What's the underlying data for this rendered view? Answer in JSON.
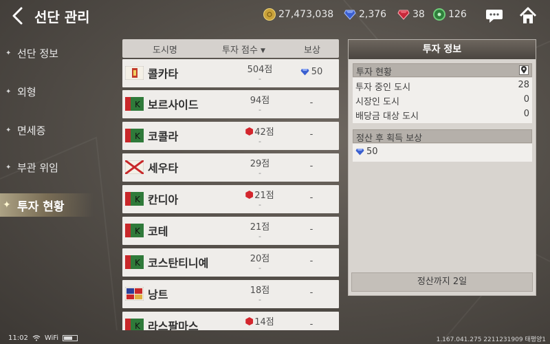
{
  "header": {
    "title": "선단 관리",
    "currencies": [
      {
        "icon": "gold-coin-icon",
        "value": "27,473,038",
        "color": "#c9a23a"
      },
      {
        "icon": "blue-gem-icon",
        "value": "2,376",
        "color": "#3a5fd0"
      },
      {
        "icon": "red-gem-icon",
        "value": "38",
        "color": "#c8283a"
      },
      {
        "icon": "green-gear-icon",
        "value": "126",
        "color": "#3aa24a"
      }
    ]
  },
  "sidebar": {
    "items": [
      {
        "label": "선단 정보",
        "active": false
      },
      {
        "label": "외형",
        "active": false
      },
      {
        "label": "면세증",
        "active": false
      },
      {
        "label": "부관 위임",
        "active": false
      },
      {
        "label": "투자 현황",
        "active": true
      }
    ]
  },
  "table": {
    "headers": {
      "city": "도시명",
      "score": "투자 점수",
      "reward": "보상"
    },
    "rows": [
      {
        "city": "콜카타",
        "score": "504점",
        "sub": "-",
        "reward": "50",
        "reward_gem": true,
        "red_marker": false
      },
      {
        "city": "보르사이드",
        "score": "94점",
        "sub": "-",
        "reward": "-",
        "reward_gem": false,
        "red_marker": false
      },
      {
        "city": "코콜라",
        "score": "42점",
        "sub": "-",
        "reward": "-",
        "reward_gem": false,
        "red_marker": true
      },
      {
        "city": "세우타",
        "score": "29점",
        "sub": "-",
        "reward": "-",
        "reward_gem": false,
        "red_marker": false
      },
      {
        "city": "칸디아",
        "score": "21점",
        "sub": "-",
        "reward": "-",
        "reward_gem": false,
        "red_marker": true
      },
      {
        "city": "코테",
        "score": "21점",
        "sub": "-",
        "reward": "-",
        "reward_gem": false,
        "red_marker": false
      },
      {
        "city": "코스탄티니예",
        "score": "20점",
        "sub": "-",
        "reward": "-",
        "reward_gem": false,
        "red_marker": false
      },
      {
        "city": "낭트",
        "score": "18점",
        "sub": "-",
        "reward": "-",
        "reward_gem": false,
        "red_marker": false
      },
      {
        "city": "라스팔마스",
        "score": "14점",
        "sub": "-",
        "reward": "-",
        "reward_gem": false,
        "red_marker": true
      }
    ]
  },
  "panel": {
    "title": "투자 정보",
    "status_section": {
      "title": "투자 현황",
      "items": [
        {
          "label": "투자 중인 도시",
          "value": "28"
        },
        {
          "label": "시장인 도시",
          "value": "0"
        },
        {
          "label": "배당금 대상 도시",
          "value": "0"
        }
      ]
    },
    "reward_section": {
      "title": "정산 후 획득 보상",
      "value": "50"
    },
    "settle_button": "정산까지 2일"
  },
  "status_bar": {
    "time": "11:02",
    "wifi": "WiFi",
    "build_info": "1.167.041.275 2211231909 태평양1"
  }
}
